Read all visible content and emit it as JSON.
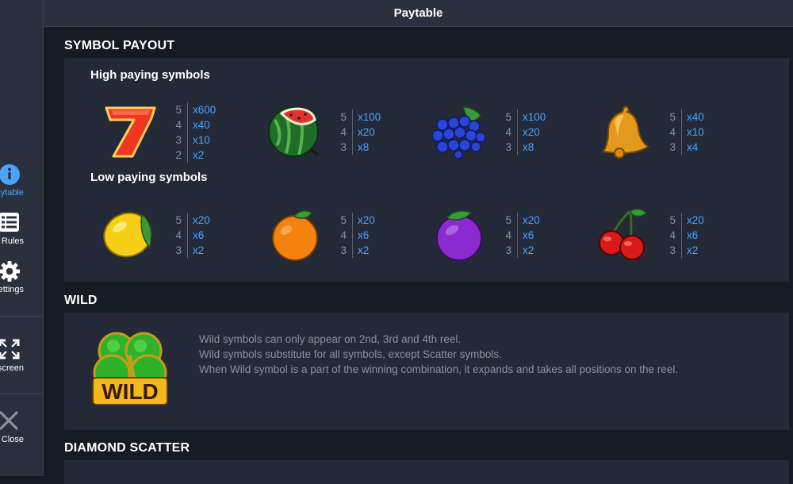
{
  "header": {
    "title": "Paytable"
  },
  "sidebar": {
    "items": [
      {
        "label": "Paytable",
        "icon": "info-icon",
        "active": true
      },
      {
        "label": "Rules",
        "icon": "list-icon",
        "active": false
      },
      {
        "label": "Settings",
        "icon": "gear-icon",
        "active": false
      },
      {
        "label": "Fullscreen",
        "icon": "fullscreen-icon",
        "active": false
      },
      {
        "label": "Close",
        "icon": "close-icon",
        "active": false
      }
    ]
  },
  "sections": {
    "symbol_payout": {
      "title": "SYMBOL PAYOUT",
      "high_title": "High paying symbols",
      "low_title": "Low paying symbols",
      "high": [
        {
          "symbol": "seven",
          "payouts": [
            {
              "count": "5",
              "mult": "x600"
            },
            {
              "count": "4",
              "mult": "x40"
            },
            {
              "count": "3",
              "mult": "x10"
            },
            {
              "count": "2",
              "mult": "x2"
            }
          ]
        },
        {
          "symbol": "watermelon",
          "payouts": [
            {
              "count": "5",
              "mult": "x100"
            },
            {
              "count": "4",
              "mult": "x20"
            },
            {
              "count": "3",
              "mult": "x8"
            }
          ]
        },
        {
          "symbol": "grapes",
          "payouts": [
            {
              "count": "5",
              "mult": "x100"
            },
            {
              "count": "4",
              "mult": "x20"
            },
            {
              "count": "3",
              "mult": "x8"
            }
          ]
        },
        {
          "symbol": "bell",
          "payouts": [
            {
              "count": "5",
              "mult": "x40"
            },
            {
              "count": "4",
              "mult": "x10"
            },
            {
              "count": "3",
              "mult": "x4"
            }
          ]
        }
      ],
      "low": [
        {
          "symbol": "lemon",
          "payouts": [
            {
              "count": "5",
              "mult": "x20"
            },
            {
              "count": "4",
              "mult": "x6"
            },
            {
              "count": "3",
              "mult": "x2"
            }
          ]
        },
        {
          "symbol": "orange",
          "payouts": [
            {
              "count": "5",
              "mult": "x20"
            },
            {
              "count": "4",
              "mult": "x6"
            },
            {
              "count": "3",
              "mult": "x2"
            }
          ]
        },
        {
          "symbol": "plum",
          "payouts": [
            {
              "count": "5",
              "mult": "x20"
            },
            {
              "count": "4",
              "mult": "x6"
            },
            {
              "count": "3",
              "mult": "x2"
            }
          ]
        },
        {
          "symbol": "cherries",
          "payouts": [
            {
              "count": "5",
              "mult": "x20"
            },
            {
              "count": "4",
              "mult": "x6"
            },
            {
              "count": "3",
              "mult": "x2"
            }
          ]
        }
      ]
    },
    "wild": {
      "title": "WILD",
      "logo_text": "WILD",
      "lines": [
        "Wild symbols can only appear on 2nd, 3rd and 4th reel.",
        "Wild symbols substitute for all symbols, except Scatter symbols.",
        "When Wild symbol is a part of the winning combination, it expands and takes all positions on the reel."
      ]
    },
    "diamond_scatter": {
      "title": "DIAMOND SCATTER"
    }
  },
  "colors": {
    "accent": "#4aa3ff",
    "background": "#151a23",
    "panel": "#232937",
    "sidebar": "#2a303d",
    "muted_text": "#8a909c"
  }
}
